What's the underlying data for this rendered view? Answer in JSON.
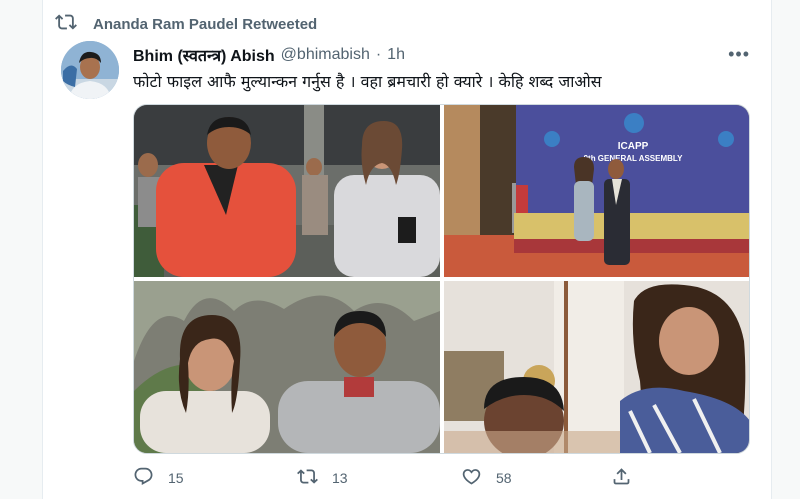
{
  "retweet_context": {
    "icon": "retweet-icon",
    "label": "Ananda Ram Paudel Retweeted"
  },
  "tweet": {
    "display_name": "Bhim (स्वतन्त्र) Abish",
    "handle": "@bhimabish",
    "separator": "·",
    "time": "1h",
    "more_icon": "more-horizontal-icon",
    "more_glyph": "•••",
    "text": "फोटो फाइल आफै मुल्यान्कन गर्नुस है । वहा ब्रमचारी हो क्यारे  । केहि शब्द जाओस",
    "photos": [
      {
        "name": "street-photo",
        "description_icon": "photo-icon"
      },
      {
        "name": "assembly-photo",
        "description_icon": "photo-icon"
      },
      {
        "name": "mountain-selfie-photo",
        "description_icon": "photo-icon"
      },
      {
        "name": "indoor-photo",
        "description_icon": "photo-icon"
      }
    ],
    "assembly_banner": {
      "line1": "ICAPP",
      "line2": "9th GENERAL ASSEMBLY"
    },
    "actions": {
      "reply": {
        "icon": "reply-icon",
        "count": "15"
      },
      "retweet": {
        "icon": "retweet-icon",
        "count": "13"
      },
      "like": {
        "icon": "heart-icon",
        "count": "58"
      },
      "share": {
        "icon": "share-icon",
        "count": ""
      }
    }
  },
  "colors": {
    "secondary_text": "#536471",
    "primary_text": "#0f1419",
    "border": "#cfd9de"
  }
}
